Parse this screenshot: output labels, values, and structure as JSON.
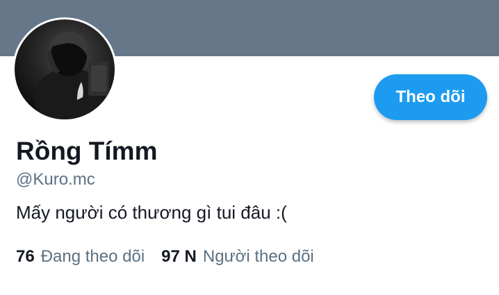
{
  "profile": {
    "display_name": "Rồng Tímm",
    "handle": "@Kuro.mc",
    "bio": "Mấy người có thương gì tui đâu :("
  },
  "actions": {
    "follow_label": "Theo dõi"
  },
  "stats": {
    "following_count": "76",
    "following_label": "Đang theo dõi",
    "followers_count": "97 N",
    "followers_label": "Người theo dõi"
  },
  "colors": {
    "banner": "#66778a",
    "accent": "#1d9bf0",
    "text_primary": "#141823",
    "text_secondary": "#5b7083"
  }
}
